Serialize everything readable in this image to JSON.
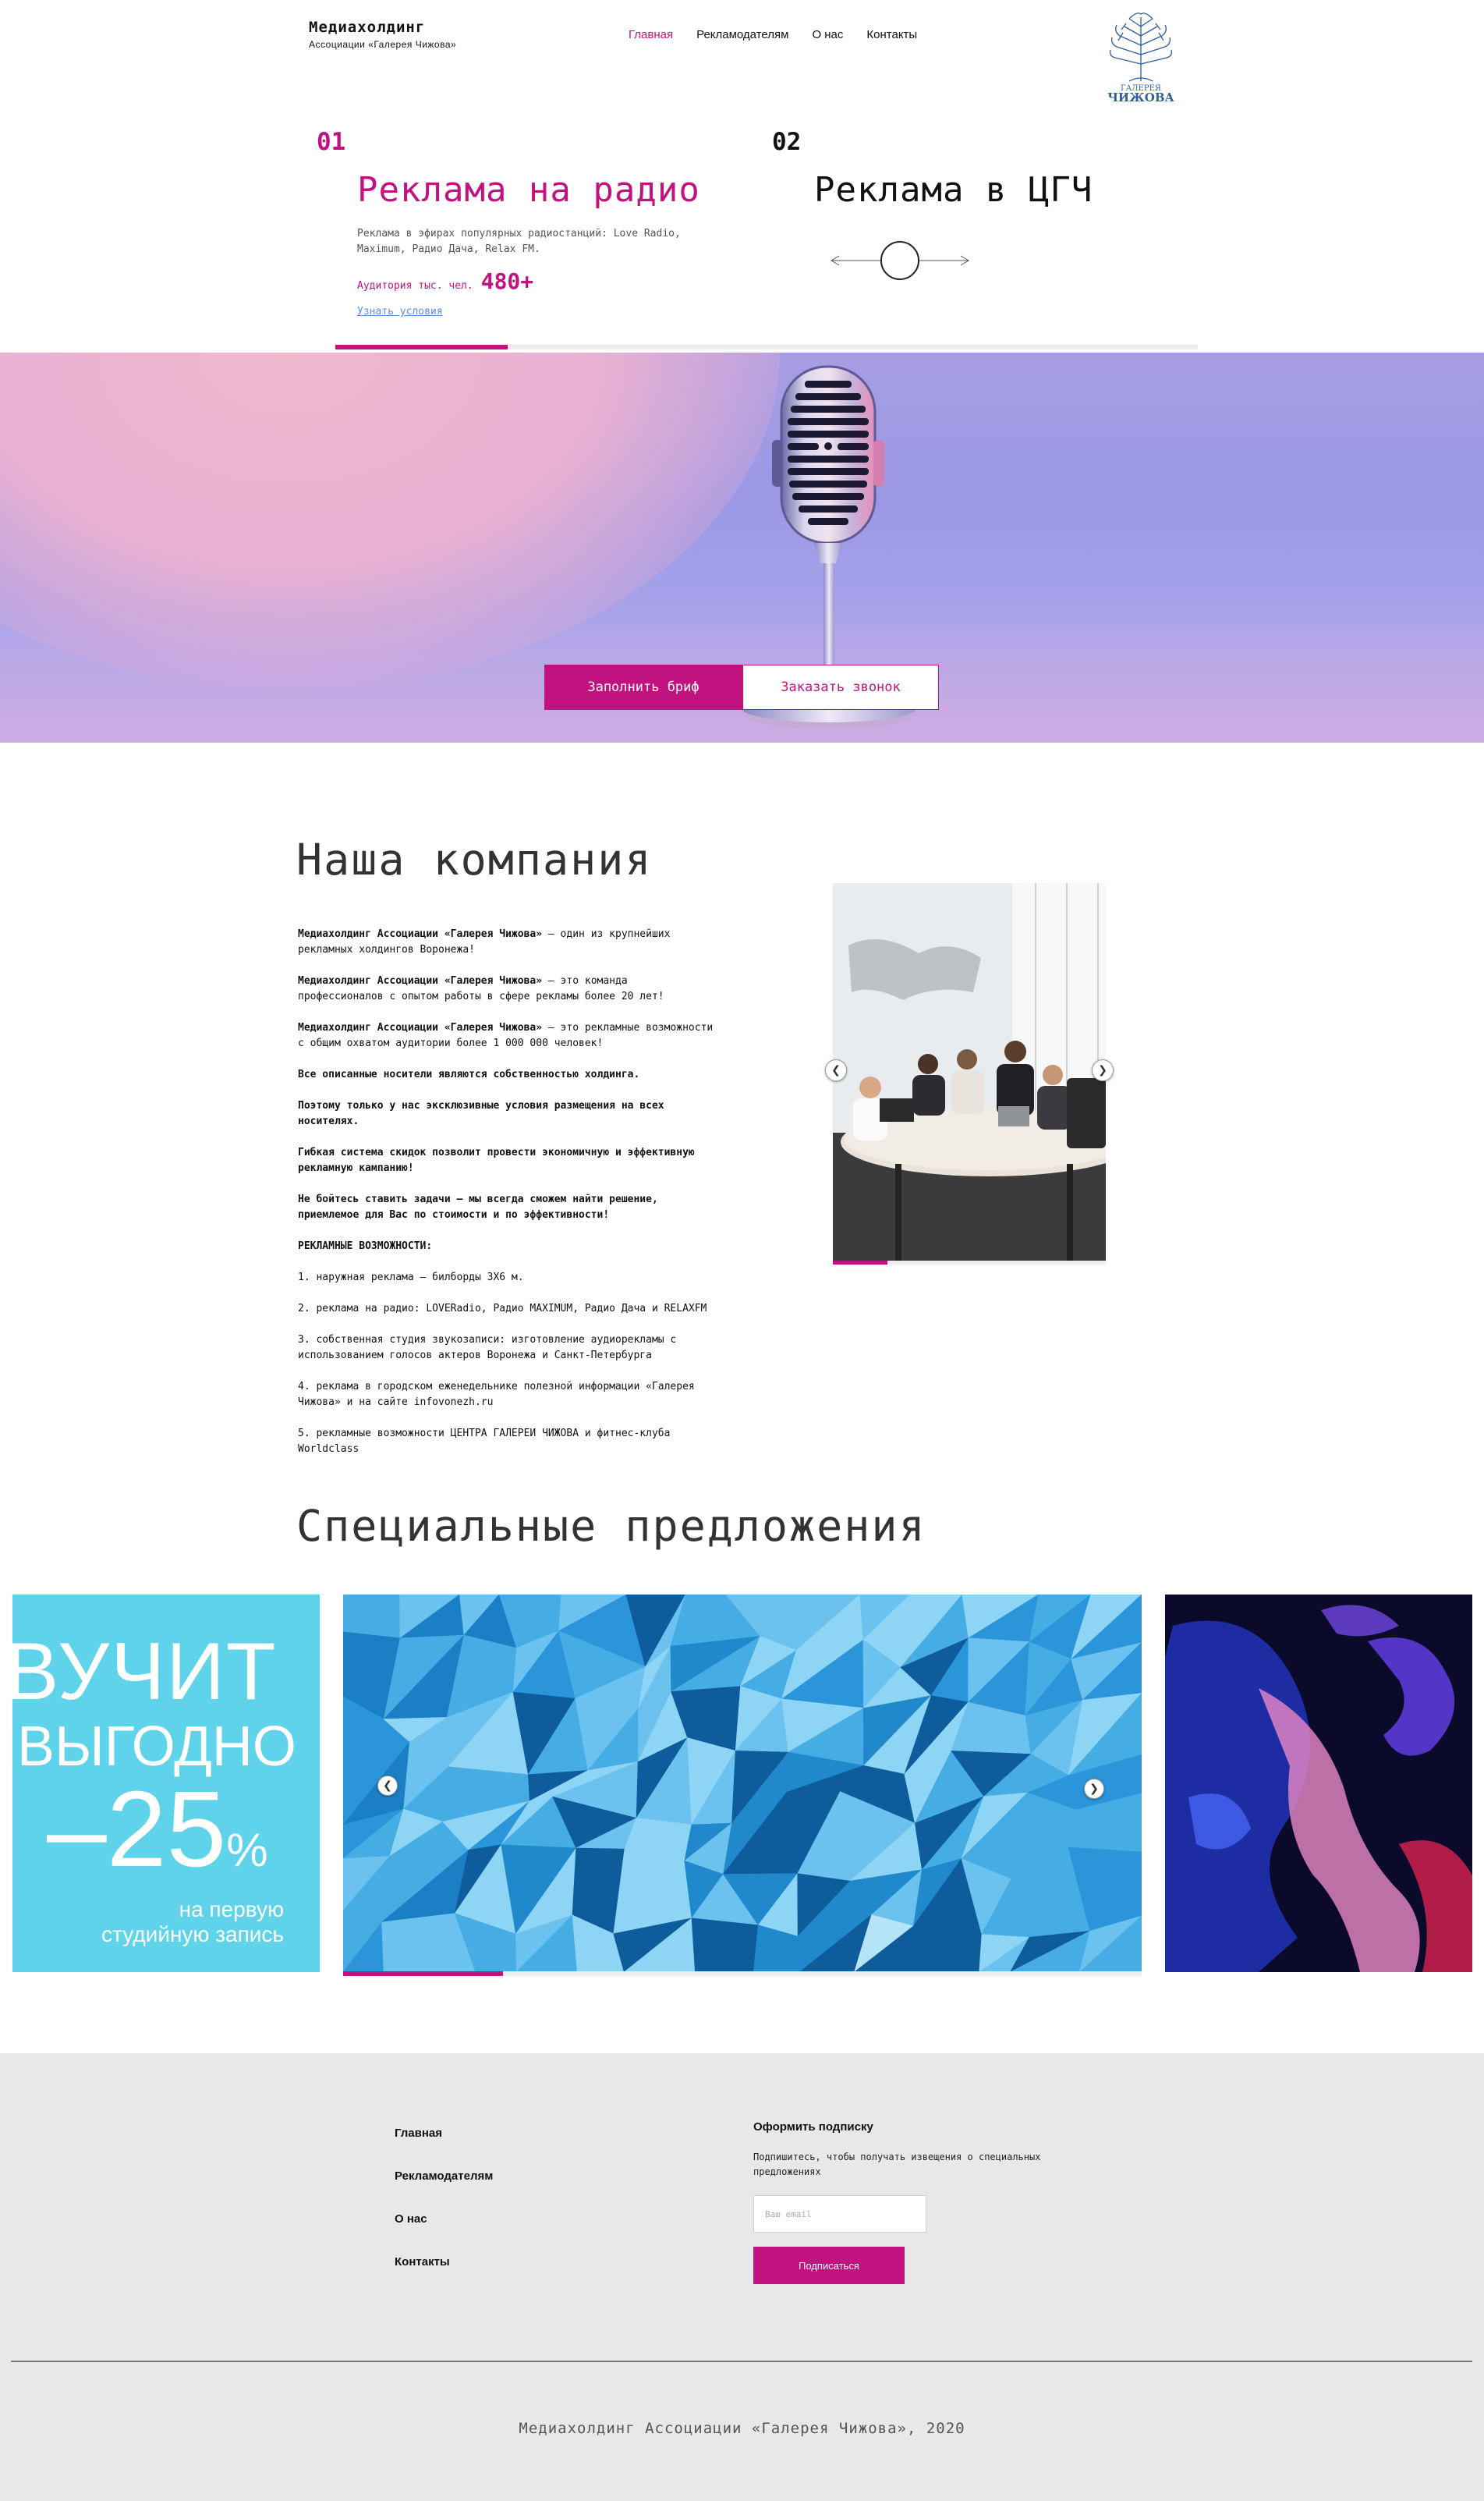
{
  "header": {
    "brand_title": "Медиахолдинг",
    "brand_subtitle": "Ассоциации «Галерея Чижова»",
    "nav": [
      {
        "label": "Главная",
        "active": true
      },
      {
        "label": "Рекламодателям",
        "active": false
      },
      {
        "label": "О нас",
        "active": false
      },
      {
        "label": "Контакты",
        "active": false
      }
    ],
    "logo_line1": "ГАЛЕРЕЯ",
    "logo_line2": "ЧИЖОВА",
    "logo_color": "#2f5f9e"
  },
  "services": [
    {
      "number": "01",
      "title": "Реклама на радио",
      "description": "Реклама в эфирах популярных радиостанций: Love Radio, Maximum, Радио Дача, Relax FM.",
      "audience_label": "Аудитория тыс. чел.",
      "audience_value": "480+",
      "link": "Узнать условия"
    },
    {
      "number": "02",
      "title": "Реклама в ЦГЧ"
    }
  ],
  "services_progress": 0.2,
  "hero": {
    "brief_button": "Заполнить бриф",
    "call_button": "Заказать звонок"
  },
  "company": {
    "heading": "Наша компания",
    "brand_name": "Медиахолдинг Ассоциации «Галерея Чижова»",
    "p1": " — один из крупнейших рекламных холдингов Воронежа!",
    "p2": " — это команда профессионалов с опытом работы в сфере рекламы более 20 лет!",
    "p3": " — это рекламные возможности с общим охватом аудитории более 1 000 000 человек!",
    "p4": "Все описанные носители являются собственностью холдинга.",
    "p5": "Поэтому только у нас эксклюзивные условия размещения на всех носителях.",
    "p6": "Гибкая система скидок позволит провести экономичную и эффективную рекламную кампанию!",
    "p7": "Не бойтесь ставить задачи — мы всегда сможем найти решение, приемлемое для Вас по стоимости и по эффективности!",
    "list_title": "РЕКЛАМНЫЕ ВОЗМОЖНОСТИ:",
    "list": [
      "1. наружная реклама — билборды 3Х6 м.",
      "2. реклама на радио: LOVERadio, Радио MAXIMUM, Радио Дача и RELAXFM",
      "3. собственная студия звукозаписи: изготовление аудиорекламы с использованием голосов актеров Воронежа и Санкт-Петербурга",
      "4. реклама в городском еженедельнике полезной информации «Галерея Чижова» и на сайте infovonezh.ru",
      "5. рекламные возможности ЦЕНТРА ГАЛЕРЕИ ЧИЖОВА и фитнес-клуба Worldclass"
    ],
    "photo_progress": 0.2
  },
  "offers": {
    "heading": "Специальные предложения",
    "promo_line1": "ВУЧИТ",
    "promo_line2": "ВЫГОДНО",
    "promo_discount": "–25",
    "promo_percent": "%",
    "promo_line4": "на первую",
    "promo_line5": "студийную запись",
    "progress": 0.2
  },
  "footer": {
    "links": [
      "Главная",
      "Рекламодателям",
      "О нас",
      "Контакты"
    ],
    "subscribe_title": "Оформить подписку",
    "subscribe_desc": "Подпишитесь, чтобы получать извещения о специальных предложениях",
    "email_placeholder": "Ваш email",
    "subscribe_button": "Подписаться",
    "copyright": "Медиахолдинг Ассоциации «Галерея Чижова», 2020"
  },
  "colors": {
    "accent": "#c2127f",
    "link": "#5b8de8",
    "footer_bg": "#e8e8e8"
  }
}
